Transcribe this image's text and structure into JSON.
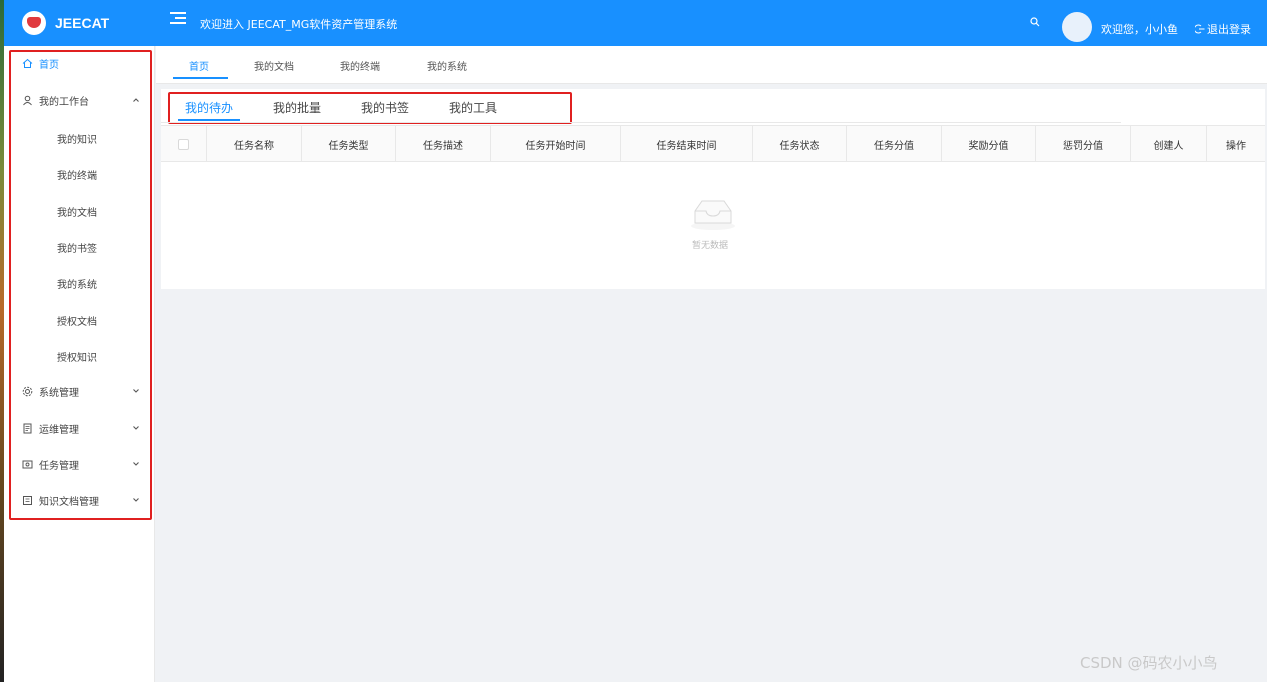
{
  "header": {
    "logo_text": "JEECAT",
    "system_title": "欢迎进入 JEECAT_MG软件资产管理系统",
    "welcome_user": "欢迎您，小小鱼",
    "logout_label": "退出登录",
    "bg_color": "#1890ff"
  },
  "sidebar": {
    "home": "首页",
    "workbench": "我的工作台",
    "workbench_items": [
      "我的知识",
      "我的终端",
      "我的文档",
      "我的书签",
      "我的系统",
      "授权文档",
      "授权知识"
    ],
    "groups": [
      "系统管理",
      "运维管理",
      "任务管理",
      "知识文档管理"
    ]
  },
  "top_tabs": [
    "首页",
    "我的文档",
    "我的终端",
    "我的系统"
  ],
  "inner_tabs": [
    "我的待办",
    "我的批量",
    "我的书签",
    "我的工具"
  ],
  "table": {
    "columns": [
      "任务名称",
      "任务类型",
      "任务描述",
      "任务开始时间",
      "任务结束时间",
      "任务状态",
      "任务分值",
      "奖励分值",
      "惩罚分值",
      "创建人",
      "操作"
    ],
    "empty_text": "暂无数据"
  },
  "watermark": "CSDN @码农小小鸟",
  "colors": {
    "accent": "#1890ff",
    "highlight_box": "#e02020"
  }
}
